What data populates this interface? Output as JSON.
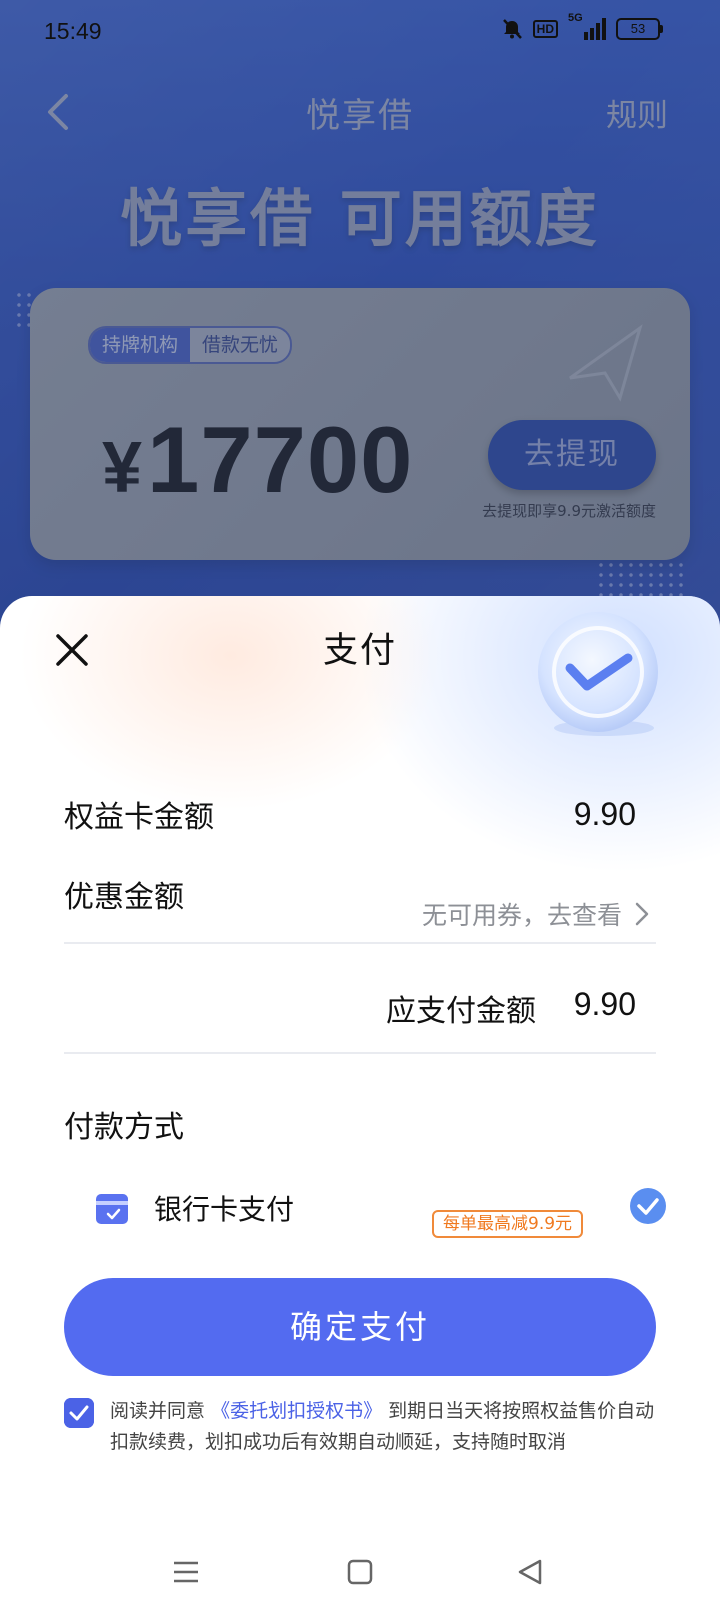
{
  "status_bar": {
    "time": "15:49",
    "signal_label": "5G",
    "hd_label": "HD",
    "battery": "53",
    "icons": [
      "mute-icon",
      "hd-icon",
      "signal-icon",
      "battery-icon"
    ]
  },
  "nav": {
    "title": "悦享借",
    "rules": "规则"
  },
  "hero": {
    "title": "悦享借 可用额度"
  },
  "card": {
    "tag_left": "持牌机构",
    "tag_right": "借款无忧",
    "currency": "¥",
    "amount": "17700",
    "withdraw_button": "去提现",
    "withdraw_note": "去提现即享9.9元激活额度"
  },
  "sheet": {
    "title": "支付",
    "card_amount_label": "权益卡金额",
    "card_amount_value": "9.90",
    "discount_label": "优惠金额",
    "discount_value": "无可用券，去查看",
    "payable_label": "应支付金额",
    "payable_value": "9.90",
    "payment_method_title": "付款方式",
    "method_label": "银行卡支付",
    "method_promo": "每单最高减9.9元",
    "confirm_button": "确定支付",
    "agreement_prefix": "阅读并同意",
    "agreement_link": "《委托划扣授权书》",
    "agreement_suffix": "到期日当天将按照权益售价自动扣款续费，划扣成功后有效期自动顺延，支持随时取消"
  },
  "colors": {
    "accent": "#536bf0",
    "promo_orange": "#f07a20",
    "check_blue": "#5a8ef0"
  }
}
